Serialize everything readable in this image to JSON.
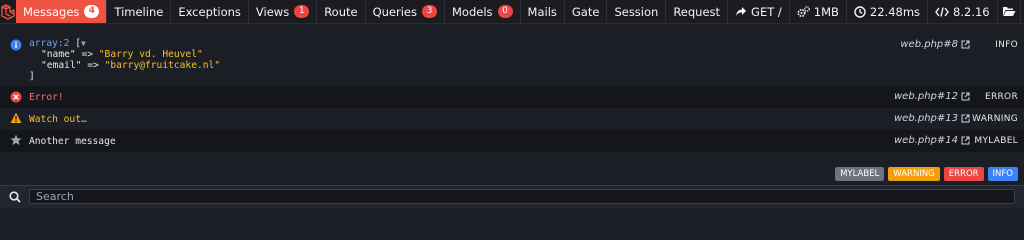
{
  "header": {
    "tabs": [
      {
        "label": "Messages",
        "badge": "4"
      },
      {
        "label": "Timeline"
      },
      {
        "label": "Exceptions"
      },
      {
        "label": "Views",
        "badge": "1"
      },
      {
        "label": "Route"
      },
      {
        "label": "Queries",
        "badge": "3"
      },
      {
        "label": "Models",
        "badge": "0"
      },
      {
        "label": "Mails"
      },
      {
        "label": "Gate"
      },
      {
        "label": "Session"
      },
      {
        "label": "Request"
      }
    ],
    "request": "GET /",
    "memory": "1MB",
    "time": "22.48ms",
    "php_version": "8.2.16"
  },
  "messages": [
    {
      "dump": {
        "type": "array:2",
        "open": "[",
        "toggle": "▼",
        "name_key": "\"name\"",
        "name_val": "\"Barry vd. Heuvel\"",
        "email_key": "\"email\"",
        "email_val": "\"barry@fruitcake.nl\"",
        "arrow": "=>",
        "close": "]"
      },
      "file": "web.php#8",
      "label": "INFO"
    },
    {
      "text": "Error!",
      "file": "web.php#12",
      "label": "ERROR"
    },
    {
      "text": "Watch out…",
      "file": "web.php#13",
      "label": "WARNING"
    },
    {
      "text": "Another message",
      "file": "web.php#14",
      "label": "MYLABEL"
    }
  ],
  "filters": [
    {
      "label": "MYLABEL",
      "color": "#6b7280"
    },
    {
      "label": "WARNING",
      "color": "#f59e0b"
    },
    {
      "label": "ERROR",
      "color": "#ef4444"
    },
    {
      "label": "INFO",
      "color": "#3b82f6"
    }
  ],
  "search": {
    "placeholder": "Search"
  }
}
